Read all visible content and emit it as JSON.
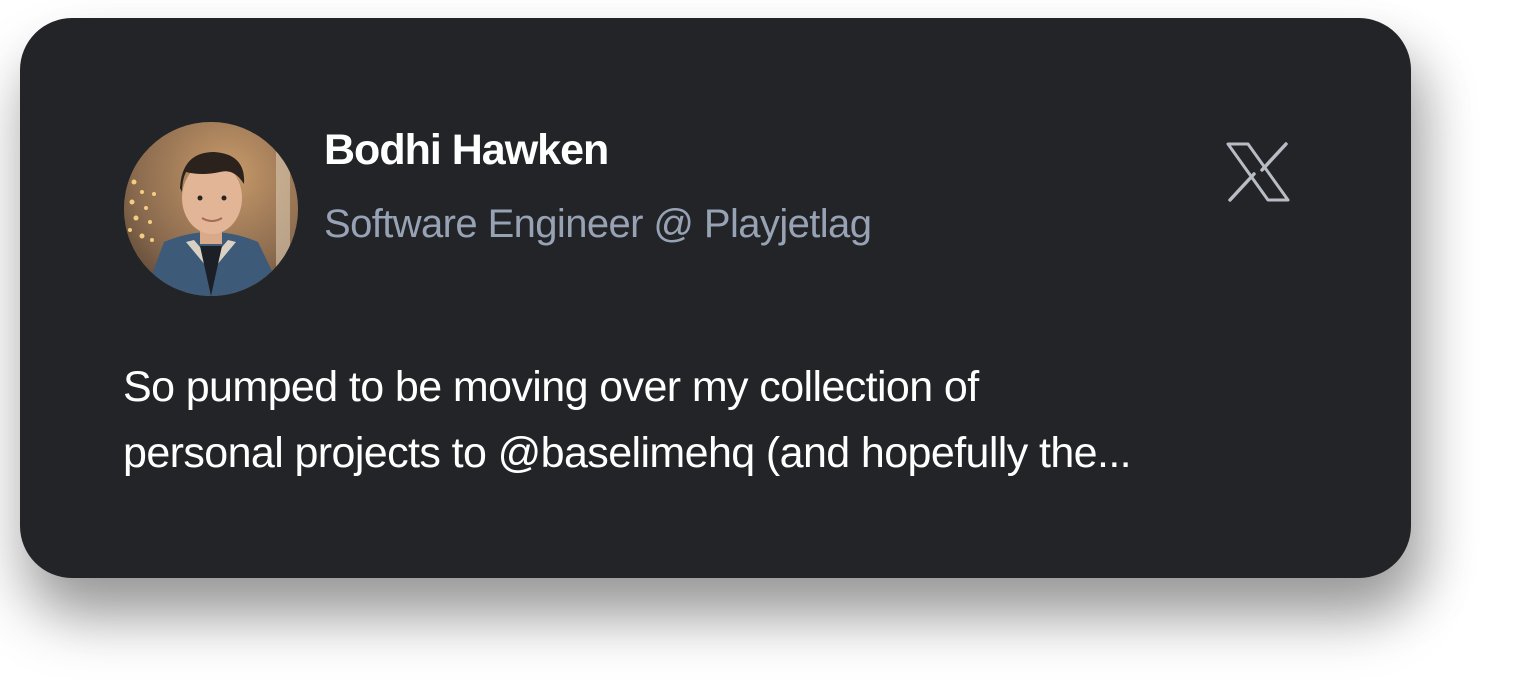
{
  "profile": {
    "name": "Bodhi Hawken",
    "title": "Software Engineer @ Playjetlag",
    "avatar_icon": "user-avatar-photo"
  },
  "platform": {
    "icon": "x-logo-icon"
  },
  "tweet": {
    "lines": [
      "So pumped to be moving over my collection of",
      "personal projects to @baselimehq (and hopefully the..."
    ]
  },
  "colors": {
    "card_background": "#232427",
    "name_text": "#ffffff",
    "title_text": "#97a2b4",
    "body_text": "#ffffff",
    "logo_stroke": "#b8bcc4"
  }
}
